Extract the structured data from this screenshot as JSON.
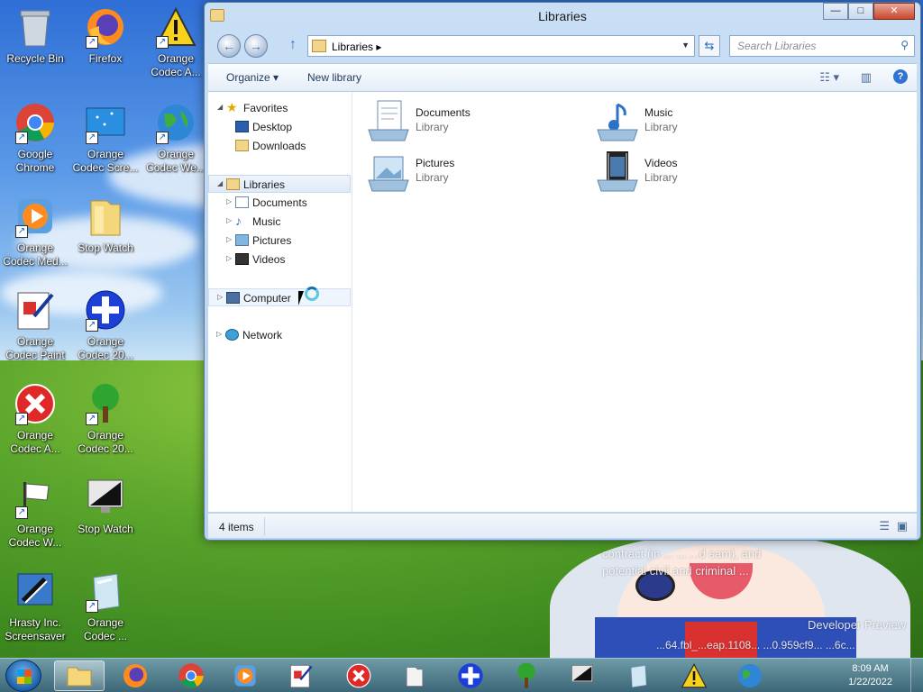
{
  "desktop": {
    "icons": [
      {
        "label": "Recycle Bin",
        "icon": "recycle-bin-icon"
      },
      {
        "label": "Firefox",
        "icon": "firefox-icon"
      },
      {
        "label": "Orange Codec A...",
        "icon": "warning-icon"
      },
      {
        "label": "Google Chrome",
        "icon": "chrome-icon"
      },
      {
        "label": "Orange Codec Scre...",
        "icon": "screen-icon"
      },
      {
        "label": "Orange Codec We...",
        "icon": "globe-icon"
      },
      {
        "label": "Orange Codec Med...",
        "icon": "media-icon"
      },
      {
        "label": "Stop Watch",
        "icon": "folder-icon"
      },
      {
        "label": "Orange Codec Paint",
        "icon": "paint-icon"
      },
      {
        "label": "Orange Codec 20...",
        "icon": "plus-icon"
      },
      {
        "label": "Orange Codec A...",
        "icon": "error-icon"
      },
      {
        "label": "Orange Codec 20...",
        "icon": "tree-icon"
      },
      {
        "label": "Orange Codec W...",
        "icon": "flag-icon"
      },
      {
        "label": "Stop Watch",
        "icon": "monitor-icon"
      },
      {
        "label": "Hrasty Inc. Screensaver",
        "icon": "screensaver-icon"
      },
      {
        "label": "Orange Codec ...",
        "icon": "glass-icon"
      }
    ],
    "overlay_lines": [
      "contract (in ... ... ...d sam), and",
      "potential civil and criminal ...",
      "Developer Preview",
      "...64.fbl_...eap.1108... ...0.959cf9... ...6c..."
    ]
  },
  "window": {
    "title": "Libraries",
    "address": {
      "crumb": "Libraries"
    },
    "search_placeholder": "Search Libraries",
    "toolbar": {
      "organize": "Organize",
      "new_library": "New library"
    },
    "nav": {
      "favorites": "Favorites",
      "desktop": "Desktop",
      "downloads": "Downloads",
      "libraries": "Libraries",
      "documents": "Documents",
      "music": "Music",
      "pictures": "Pictures",
      "videos": "Videos",
      "computer": "Computer",
      "network": "Network"
    },
    "libraries": [
      {
        "name": "Documents",
        "type": "Library"
      },
      {
        "name": "Music",
        "type": "Library"
      },
      {
        "name": "Pictures",
        "type": "Library"
      },
      {
        "name": "Videos",
        "type": "Library"
      }
    ],
    "status": "4 items"
  },
  "taskbar": {
    "time": "8:09 AM",
    "date": "1/22/2022"
  }
}
